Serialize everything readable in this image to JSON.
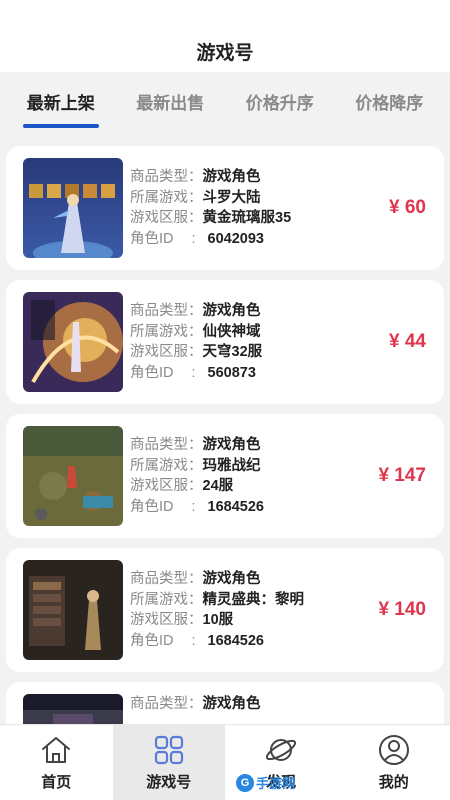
{
  "header": {
    "title": "游戏号"
  },
  "tabs": [
    {
      "label": "最新上架",
      "active": true
    },
    {
      "label": "最新出售",
      "active": false
    },
    {
      "label": "价格升序",
      "active": false
    },
    {
      "label": "价格降序",
      "active": false
    }
  ],
  "labels": {
    "type": "商品类型：",
    "game": "所属游戏：",
    "server": "游戏区服：",
    "role_id": "角色ID",
    "colon": ":"
  },
  "listings": [
    {
      "type": "游戏角色",
      "game": "斗罗大陆",
      "server": "黄金琉璃服35",
      "role_id": "6042093",
      "price": "¥ 60"
    },
    {
      "type": "游戏角色",
      "game": "仙侠神域",
      "server": "天穹32服",
      "role_id": "560873",
      "price": "¥ 44"
    },
    {
      "type": "游戏角色",
      "game": "玛雅战纪",
      "server": "24服",
      "role_id": "1684526",
      "price": "¥ 147"
    },
    {
      "type": "游戏角色",
      "game": "精灵盛典：黎明",
      "server": "10服",
      "role_id": "1684526",
      "price": "¥ 140"
    },
    {
      "type": "游戏角色"
    }
  ],
  "nav": [
    {
      "label": "首页",
      "icon": "home-icon",
      "active": false
    },
    {
      "label": "游戏号",
      "icon": "grid-icon",
      "active": true
    },
    {
      "label": "发现",
      "icon": "planet-icon",
      "active": false
    },
    {
      "label": "我的",
      "icon": "user-icon",
      "active": false
    }
  ],
  "watermark": {
    "badge": "G",
    "text": "手游网"
  },
  "colors": {
    "accent": "#1a56c8",
    "price": "#e0364d"
  }
}
